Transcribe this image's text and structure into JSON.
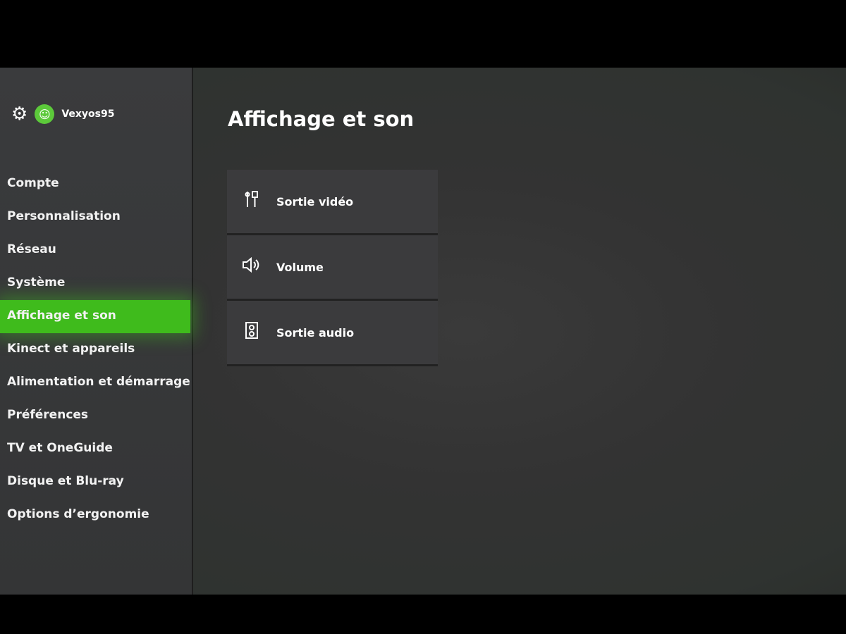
{
  "profile": {
    "gamertag": "Vexyos95",
    "settings_icon": "gear-icon",
    "avatar_icon": "avatar"
  },
  "page_title": "Affichage et son",
  "sidebar": {
    "items": [
      {
        "label": "Compte"
      },
      {
        "label": "Personnalisation"
      },
      {
        "label": "Réseau"
      },
      {
        "label": "Système"
      },
      {
        "label": "Affichage et son",
        "active": true
      },
      {
        "label": "Kinect et appareils"
      },
      {
        "label": "Alimentation et démarrage"
      },
      {
        "label": "Préférences"
      },
      {
        "label": "TV et OneGuide"
      },
      {
        "label": "Disque et Blu-ray"
      },
      {
        "label": "Options d’ergonomie"
      }
    ]
  },
  "menu": {
    "items": [
      {
        "label": "Sortie vidéo",
        "icon": "hdmi-cable-icon"
      },
      {
        "label": "Volume",
        "icon": "speaker-volume-icon"
      },
      {
        "label": "Sortie audio",
        "icon": "speaker-box-icon"
      }
    ]
  },
  "colors": {
    "accent": "#3fbb1c",
    "background": "#353535"
  }
}
